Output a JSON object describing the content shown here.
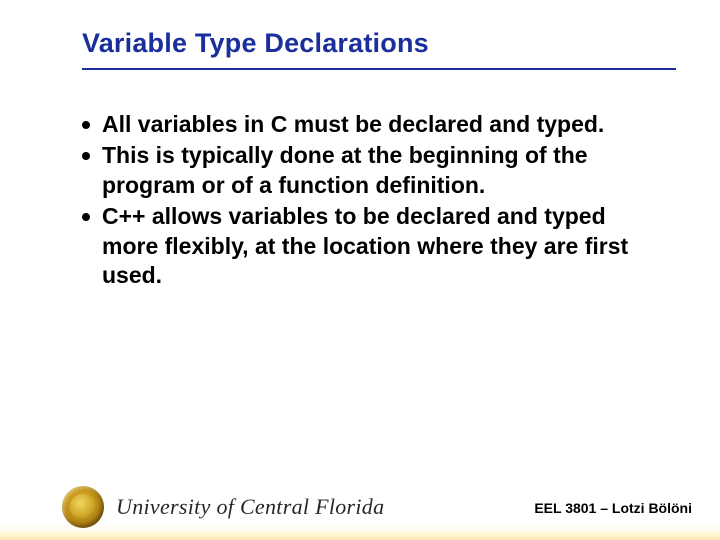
{
  "title": "Variable Type Declarations",
  "bullets": [
    "All variables in C must be declared and typed.",
    "This is typically done at the beginning of the program or of a function definition.",
    "C++ allows variables to be declared and typed more flexibly, at the location where they are first used."
  ],
  "footer": {
    "university": "University of Central Florida",
    "course": "EEL 3801 – Lotzi Bölöni"
  }
}
